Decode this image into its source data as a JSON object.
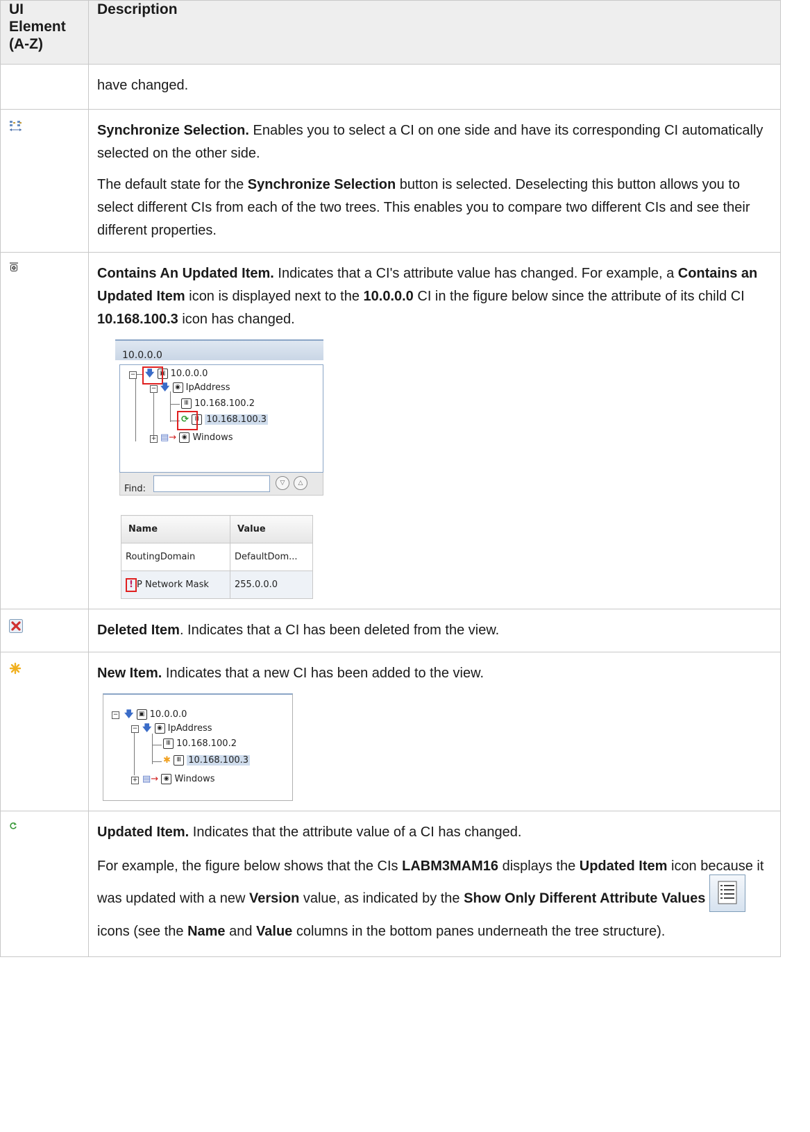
{
  "header": {
    "col1": "UI Element\n(A-Z)",
    "col1_line1": "UI Element",
    "col1_line2": "(A-Z)",
    "col2": "Description"
  },
  "rows": {
    "continued": {
      "text": "have changed."
    },
    "sync": {
      "icon": "synchronize-selection-icon",
      "title": "Synchronize Selection.",
      "text1": " Enables you to select a CI on one side and have its corresponding CI automatically selected on the other side.",
      "p2_a": "The default state for the ",
      "p2_b": "Synchronize Selection",
      "p2_c": " button is selected. Deselecting this button allows you to select different CIs from each of the two trees. This enables you to compare two different CIs and see their different properties."
    },
    "contains": {
      "icon": "contains-updated-item-icon",
      "title": "Contains An Updated Item.",
      "t1": " Indicates that a CI's attribute value has changed. For example, a ",
      "t2": "Contains an Updated Item",
      "t3": " icon is displayed next to the ",
      "t4": "10.0.0.0",
      "t5": " CI in the figure below since the attribute of its child CI ",
      "t6": "10.168.100.3",
      "t7": " icon has changed.",
      "figure": {
        "title": "10.0.0.0",
        "nodes": {
          "root": "10.0.0.0",
          "ip": "IpAddress",
          "a": "10.168.100.2",
          "b": "10.168.100.3",
          "win": "Windows"
        },
        "find_label": "Find:",
        "props": {
          "headers": [
            "Name",
            "Value"
          ],
          "rows": [
            [
              "RoutingDomain",
              "DefaultDom..."
            ],
            [
              "IP Network Mask",
              "255.0.0.0"
            ]
          ],
          "row2_name": "P Network Mask"
        }
      }
    },
    "deleted": {
      "icon": "deleted-item-icon",
      "title": "Deleted Item",
      "text": ". Indicates that a CI has been deleted from the view."
    },
    "new": {
      "icon": "new-item-icon",
      "title": "New Item.",
      "text": " Indicates that a new CI has been added to the view.",
      "figure": {
        "nodes": {
          "root": "10.0.0.0",
          "ip": "IpAddress",
          "a": "10.168.100.2",
          "b": "10.168.100.3",
          "win": "Windows"
        }
      }
    },
    "updated": {
      "icon": "updated-item-icon",
      "title": "Updated Item.",
      "text": " Indicates that the attribute value of a CI has changed.",
      "p2_a": "For example, the figure below shows that the CIs ",
      "p2_b": "LABM3MAM16",
      "p2_c": " displays the ",
      "p2_d": "Updated Item",
      "p2_e": " icon because it was updated with a new ",
      "p2_f": "Version",
      "p2_g": " value, as indicated by the ",
      "p2_h": "Show Only Different Attribute Values",
      "p2_i": " icons (see the ",
      "p2_j": "Name",
      "p2_k": " and ",
      "p2_l": "Value",
      "p2_m": " columns in the bottom panes underneath the tree structure)."
    }
  },
  "colors": {
    "header_bg": "#eeeeee",
    "border": "#c8c8c8",
    "highlight_red": "#e02020",
    "tree_select": "#cfdcec"
  }
}
